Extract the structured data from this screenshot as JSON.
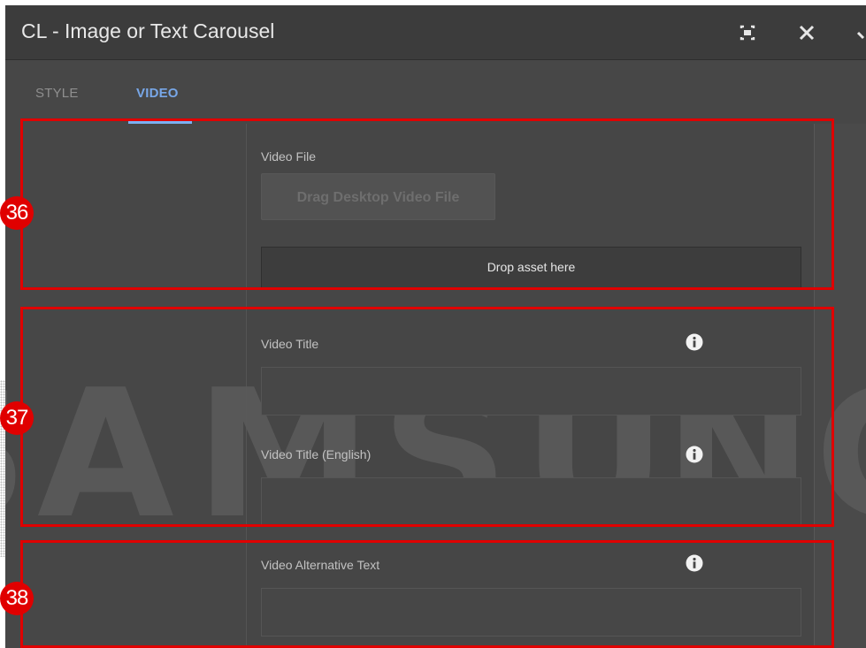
{
  "dialog": {
    "title": "CL - Image or Text Carousel",
    "icons": [
      "fullscreen-icon",
      "close-icon",
      "check-icon"
    ]
  },
  "tabs": [
    {
      "label": "STYLE",
      "active": false
    },
    {
      "label": "VIDEO",
      "active": true
    }
  ],
  "video_tab": {
    "video_file": {
      "label": "Video File",
      "drag_button": "Drag Desktop Video File",
      "drop_zone": "Drop asset here"
    },
    "video_title": {
      "label": "Video Title",
      "value": ""
    },
    "video_title_english": {
      "label": "Video Title (English)",
      "value": ""
    },
    "video_alt_text": {
      "label": "Video Alternative Text",
      "value": ""
    }
  },
  "watermark": "SAMSUNG",
  "annotations": [
    "36",
    "37",
    "38"
  ],
  "colors": {
    "accent": "#7bb0f2",
    "highlight": "#e00000",
    "panel": "#474747"
  }
}
